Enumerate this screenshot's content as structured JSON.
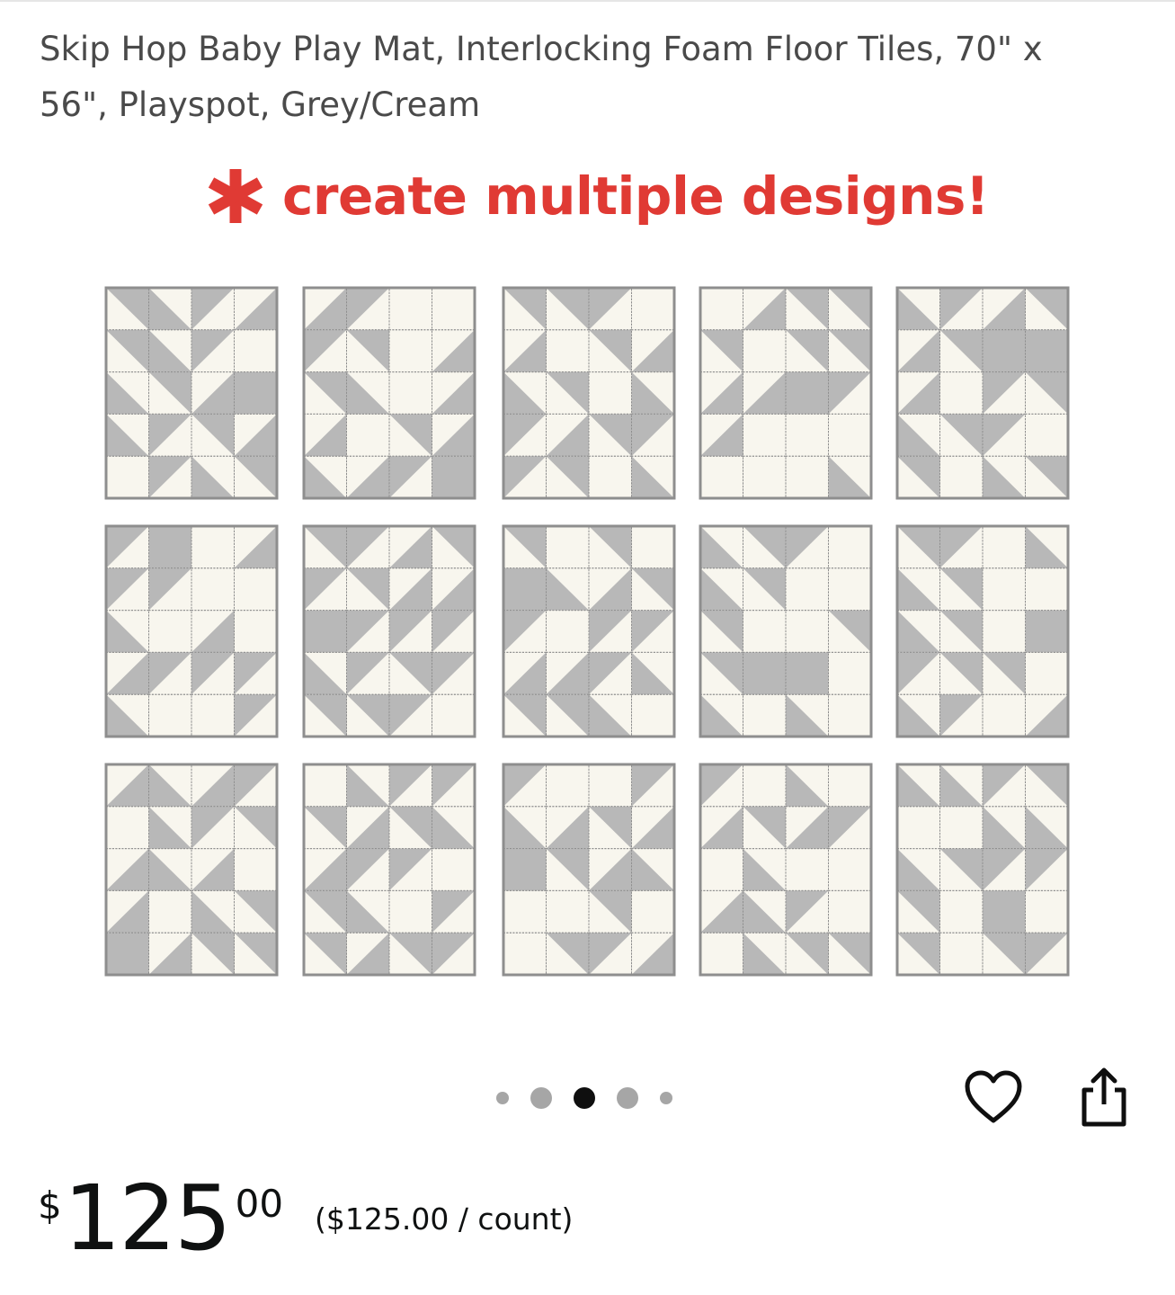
{
  "product": {
    "title": "Skip Hop Baby Play Mat, Interlocking Foam Floor Tiles, 70\" x 56\", Playspot, Grey/Cream"
  },
  "gallery": {
    "headline": "create multiple designs!",
    "asterisk_icon": "asterisk-icon",
    "colors": {
      "accent": "#e03a34",
      "tile_grey": "#b8b8b8",
      "tile_cream": "#f8f6ee",
      "seam": "#8e8e8e"
    },
    "designs_count": 15,
    "carousel": {
      "total": 5,
      "active_index": 2
    }
  },
  "actions": {
    "wishlist_icon": "heart-icon",
    "share_icon": "share-icon"
  },
  "price": {
    "symbol": "$",
    "whole": "125",
    "fraction": "00",
    "unit": "($125.00 / count)"
  }
}
